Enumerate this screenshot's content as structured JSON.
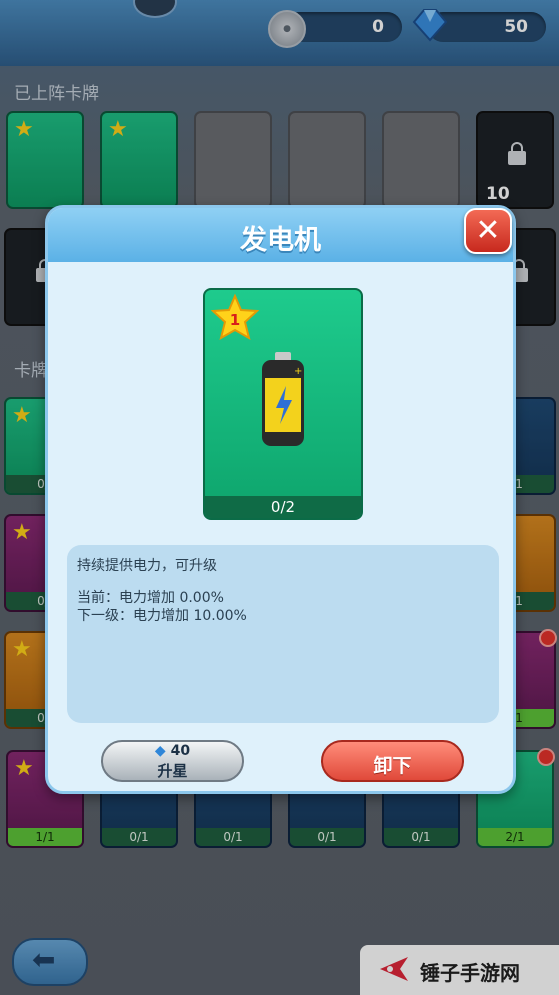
{
  "currency": {
    "coin_value": "0",
    "gem_value": "50",
    "coin_icon": "coin-icon",
    "gem_icon": "blue-gem-icon"
  },
  "sections": {
    "equipped_title": "已上阵卡牌",
    "cards_title_partial": "卡牌"
  },
  "equipped": {
    "locked_slot_cost": "10"
  },
  "grid_counts": [
    "0/1",
    "0/1",
    "0/1",
    "0/1",
    "1/1",
    "2/1"
  ],
  "row3_counts": [
    "1/1",
    "0/1",
    "0/1",
    "0/1",
    "0/1",
    "2/1"
  ],
  "side_counts": {
    "left_partial": [
      "0/",
      "0/",
      "0/"
    ],
    "right_partial": [
      "/1",
      "/1",
      "/1"
    ]
  },
  "modal": {
    "title": "发电机",
    "card": {
      "star_level": "1",
      "progress": "0/2",
      "icon": "battery-icon"
    },
    "description": "持续提供电力，可升级",
    "current": "当前：电力增加 0.00%",
    "next": "下一级：电力增加 10.00%",
    "upgrade_cost": "40",
    "upgrade_label": "升星",
    "unload_label": "卸下"
  },
  "watermark": {
    "text": "锤子手游网"
  },
  "colors": {
    "card_green": "#14b27a",
    "modal_bg": "#dff1fb",
    "upgrade_btn": "#d7dde1",
    "unload_btn": "#ef5e4c"
  }
}
